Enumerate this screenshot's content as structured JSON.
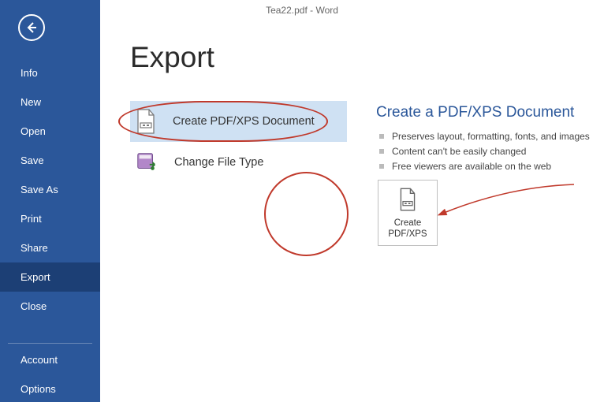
{
  "app_title": "Tea22.pdf - Word",
  "sidebar": {
    "items": [
      {
        "label": "Info",
        "selected": false
      },
      {
        "label": "New",
        "selected": false
      },
      {
        "label": "Open",
        "selected": false
      },
      {
        "label": "Save",
        "selected": false
      },
      {
        "label": "Save As",
        "selected": false
      },
      {
        "label": "Print",
        "selected": false
      },
      {
        "label": "Share",
        "selected": false
      },
      {
        "label": "Export",
        "selected": true
      },
      {
        "label": "Close",
        "selected": false
      }
    ],
    "footer_items": [
      {
        "label": "Account"
      },
      {
        "label": "Options"
      }
    ]
  },
  "page": {
    "title": "Export",
    "options": [
      {
        "label": "Create PDF/XPS Document",
        "selected": true,
        "icon": "pdf-page-icon"
      },
      {
        "label": "Change File Type",
        "selected": false,
        "icon": "change-filetype-icon"
      }
    ],
    "right_panel": {
      "title": "Create a PDF/XPS Document",
      "bullets": [
        "Preserves layout, formatting, fonts, and images",
        "Content can't be easily changed",
        "Free viewers are available on the web"
      ],
      "big_button": {
        "line1": "Create",
        "line2": "PDF/XPS"
      }
    }
  },
  "annotations": {
    "ellipse_over_option": true,
    "circle_over_button": true,
    "arrow_to_button": true
  }
}
